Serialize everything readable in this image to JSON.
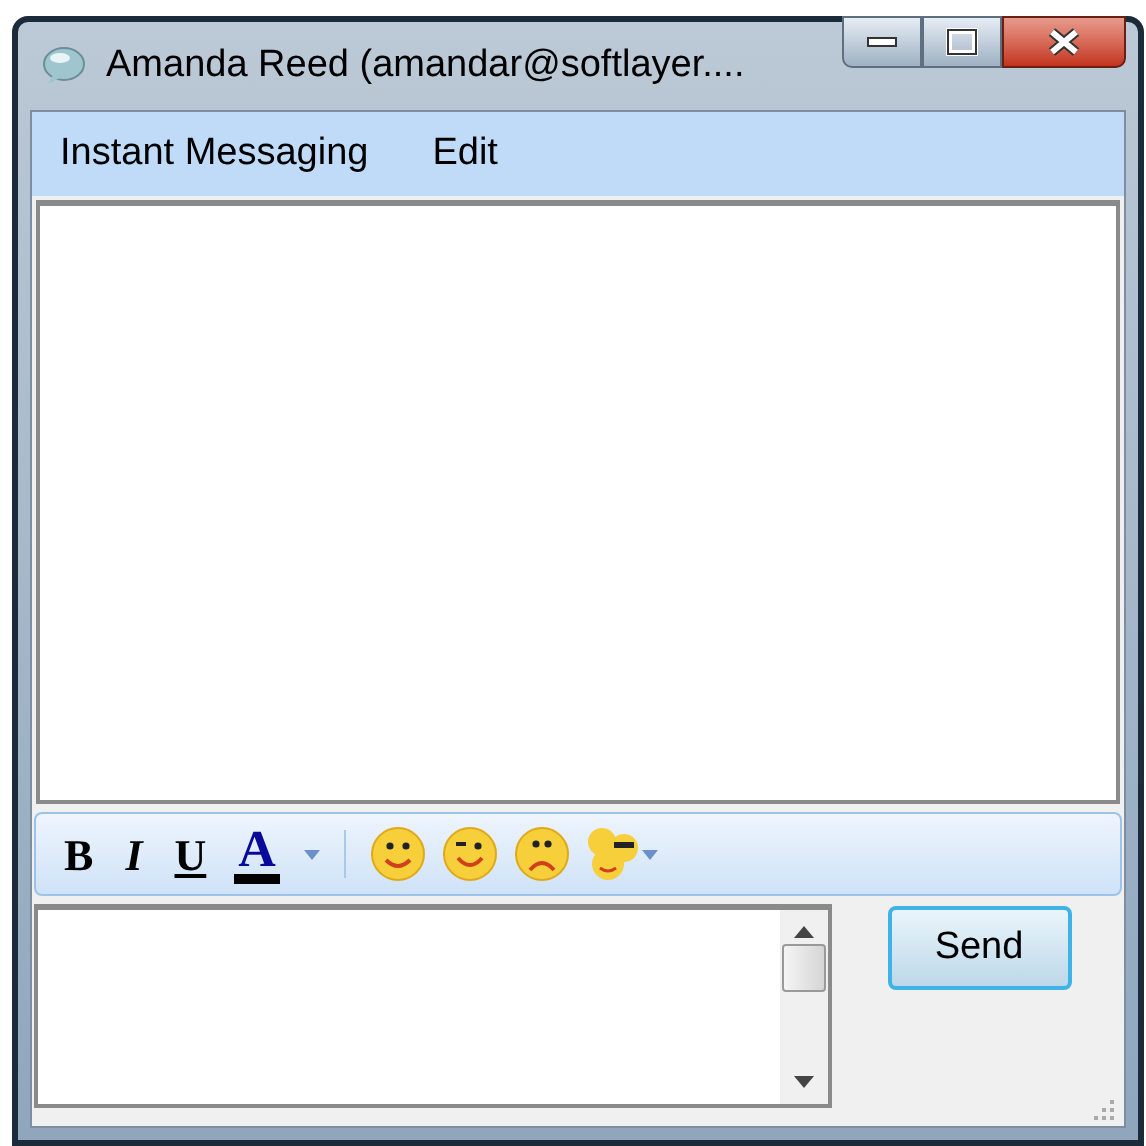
{
  "window": {
    "title": "Amanda Reed (amandar@softlayer...."
  },
  "menu": [
    {
      "label": "Instant Messaging"
    },
    {
      "label": "Edit"
    }
  ],
  "format_toolbar": [
    {
      "kind": "bold",
      "label": "B"
    },
    {
      "kind": "italic",
      "label": "I"
    },
    {
      "kind": "underline",
      "label": "U"
    },
    {
      "kind": "color",
      "label": "A"
    }
  ],
  "send_button": "Send"
}
